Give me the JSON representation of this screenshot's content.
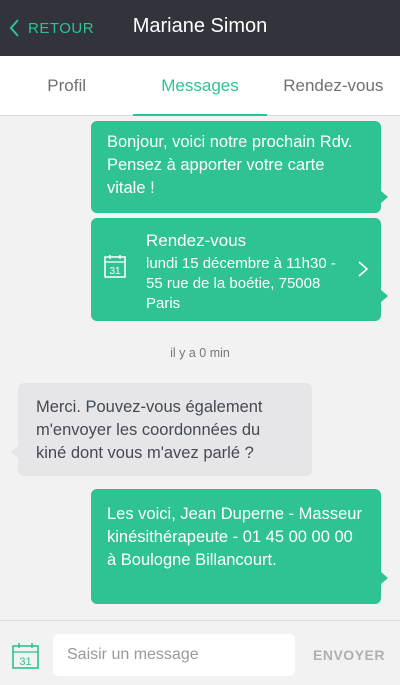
{
  "header": {
    "back_label": "RETOUR",
    "title": "Mariane Simon"
  },
  "tabs": [
    {
      "label": "Profil",
      "active": false
    },
    {
      "label": "Messages",
      "active": true
    },
    {
      "label": "Rendez-vous",
      "active": false
    }
  ],
  "messages": {
    "m1": {
      "text": "Bonjour, voici notre prochain Rdv. Pensez à apporter votre carte vitale !"
    },
    "appointment": {
      "title": "Rendez-vous",
      "details": "lundi 15 décembre à 11h30 - 55 rue de la boétie, 75008 Paris",
      "icon_number": "31"
    },
    "timestamp": "il y a 0 min",
    "m2": {
      "text": "Merci. Pouvez-vous également m'envoyer les coordonnées du kiné dont vous m'avez parlé ?"
    },
    "m3": {
      "text": "Les voici, Jean Duperne - Masseur kinésithérapeute - 01 45 00 00 00 à Boulogne Billancourt."
    }
  },
  "footer": {
    "input_placeholder": "Saisir un message",
    "input_value": "",
    "send_label": "ENVOYER",
    "calendar_icon_number": "31"
  },
  "colors": {
    "accent": "#2ec295",
    "header_bg": "#31343b",
    "incoming_bubble": "#e6e6e9"
  },
  "icons": {
    "back": "chevron-left-icon",
    "appointment": "calendar-icon",
    "open_appointment": "chevron-right-icon",
    "attach_appointment": "calendar-icon"
  }
}
